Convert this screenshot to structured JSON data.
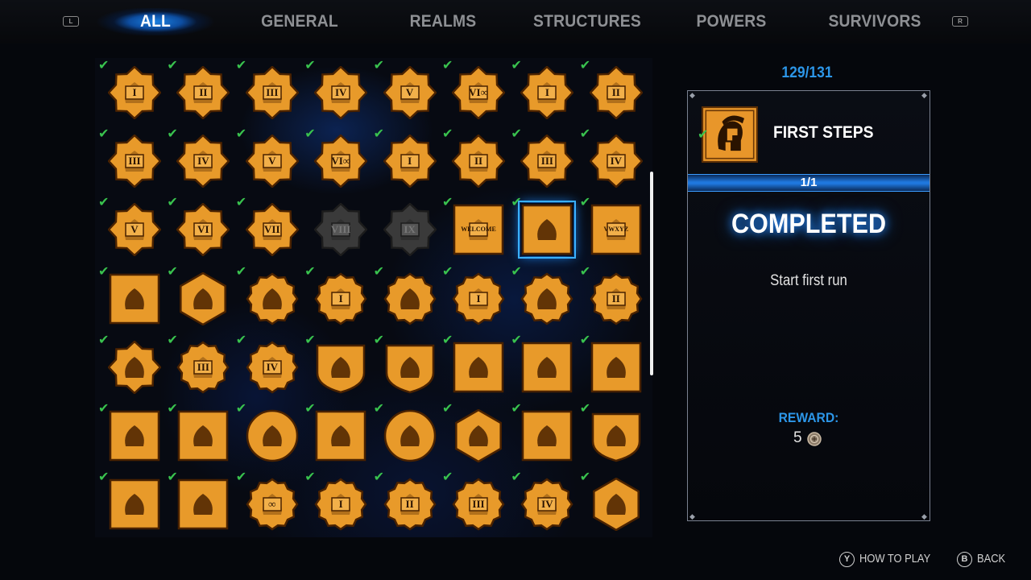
{
  "tabs": {
    "left_shoulder": "L",
    "right_shoulder": "R",
    "items": [
      {
        "label": "ALL",
        "active": true
      },
      {
        "label": "GENERAL",
        "active": false
      },
      {
        "label": "REALMS",
        "active": false
      },
      {
        "label": "STRUCTURES",
        "active": false
      },
      {
        "label": "POWERS",
        "active": false
      },
      {
        "label": "SURVIVORS",
        "active": false
      }
    ]
  },
  "grid": {
    "columns": 8,
    "achievements": [
      {
        "icon": "star-badge-flame-icon",
        "numeral": "I",
        "done": true
      },
      {
        "icon": "star-badge-flame-icon",
        "numeral": "II",
        "done": true
      },
      {
        "icon": "star-badge-flame-icon",
        "numeral": "III",
        "done": true
      },
      {
        "icon": "star-badge-flame-icon",
        "numeral": "IV",
        "done": true
      },
      {
        "icon": "star-badge-flame-icon",
        "numeral": "V",
        "done": true
      },
      {
        "icon": "star-badge-flame-icon",
        "numeral": "VI∞",
        "done": true
      },
      {
        "icon": "star-badge-cards-icon",
        "numeral": "I",
        "done": true
      },
      {
        "icon": "star-badge-cards-icon",
        "numeral": "II",
        "done": true
      },
      {
        "icon": "star-badge-cards-icon",
        "numeral": "III",
        "done": true
      },
      {
        "icon": "star-badge-cards-icon",
        "numeral": "IV",
        "done": true
      },
      {
        "icon": "star-badge-cards-icon",
        "numeral": "V",
        "done": true
      },
      {
        "icon": "star-badge-cards-icon",
        "numeral": "VI∞",
        "done": true
      },
      {
        "icon": "star-badge-skull-icon",
        "numeral": "I",
        "done": true
      },
      {
        "icon": "star-badge-skull-icon",
        "numeral": "II",
        "done": true
      },
      {
        "icon": "star-badge-skull-icon",
        "numeral": "III",
        "done": true
      },
      {
        "icon": "star-badge-skull-icon",
        "numeral": "IV",
        "done": true
      },
      {
        "icon": "star-badge-skull-icon",
        "numeral": "V",
        "done": true
      },
      {
        "icon": "star-badge-skull-icon",
        "numeral": "VI",
        "done": true
      },
      {
        "icon": "star-badge-skull-icon",
        "numeral": "VII",
        "done": true
      },
      {
        "icon": "star-badge-skull-icon",
        "numeral": "VIII",
        "done": false
      },
      {
        "icon": "star-badge-skull-icon",
        "numeral": "IX",
        "done": false
      },
      {
        "icon": "welcome-fire-icon",
        "numeral": "WELCOME",
        "done": true
      },
      {
        "icon": "spartan-helmet-icon",
        "numeral": "",
        "done": true,
        "selected": true
      },
      {
        "icon": "alphabet-tablet-icon",
        "numeral": "VWXYZ",
        "done": true
      },
      {
        "icon": "fruit-basket-icon",
        "numeral": "",
        "done": true
      },
      {
        "icon": "gold-bars-icon",
        "numeral": "",
        "done": true
      },
      {
        "icon": "laurel-face-icon",
        "numeral": "",
        "done": true
      },
      {
        "icon": "laurel-coin-icon",
        "numeral": "I",
        "done": true
      },
      {
        "icon": "temple-icon",
        "numeral": "",
        "done": true
      },
      {
        "icon": "laurel-sun-icon",
        "numeral": "I",
        "done": true
      },
      {
        "icon": "volcano-icon",
        "numeral": "",
        "done": true
      },
      {
        "icon": "laurel-sun-icon",
        "numeral": "II",
        "done": true
      },
      {
        "icon": "star-badge-cards-icon",
        "numeral": "",
        "done": true
      },
      {
        "icon": "laurel-sun-icon",
        "numeral": "III",
        "done": true
      },
      {
        "icon": "laurel-sun-icon",
        "numeral": "IV",
        "done": true
      },
      {
        "icon": "winged-sword-shield-icon",
        "numeral": "",
        "done": true
      },
      {
        "icon": "god-statue-shield-icon",
        "numeral": "",
        "done": true
      },
      {
        "icon": "treasure-chest-icon",
        "numeral": "",
        "done": true
      },
      {
        "icon": "spell-book-icon",
        "numeral": "",
        "done": true
      },
      {
        "icon": "ram-demon-icon",
        "numeral": "",
        "done": true
      },
      {
        "icon": "crowned-skull-icon",
        "numeral": "",
        "done": true
      },
      {
        "icon": "hooded-figure-icon",
        "numeral": "",
        "done": true
      },
      {
        "icon": "warrior-fist-icon",
        "numeral": "",
        "done": true
      },
      {
        "icon": "hammer-warrior-icon",
        "numeral": "",
        "done": true
      },
      {
        "icon": "flexing-arm-icon",
        "numeral": "",
        "done": true
      },
      {
        "icon": "miner-helmet-icon",
        "numeral": "",
        "done": true
      },
      {
        "icon": "duo-fighters-icon",
        "numeral": "",
        "done": true
      },
      {
        "icon": "shield-warrior-icon",
        "numeral": "",
        "done": true
      },
      {
        "icon": "castle-tower-icon",
        "numeral": "",
        "done": true
      },
      {
        "icon": "oracle-icon",
        "numeral": "",
        "done": true
      },
      {
        "icon": "laurel-infinity-icon",
        "numeral": "∞",
        "done": true
      },
      {
        "icon": "clover-numeral-icon",
        "numeral": "I",
        "done": true
      },
      {
        "icon": "clover-numeral-icon",
        "numeral": "II",
        "done": true
      },
      {
        "icon": "clover-numeral-icon",
        "numeral": "III",
        "done": true
      },
      {
        "icon": "clover-numeral-icon",
        "numeral": "IV",
        "done": true
      },
      {
        "icon": "hexagon-beast-icon",
        "numeral": "",
        "done": true
      }
    ]
  },
  "detail": {
    "count": "129/131",
    "icon": "spartan-helmet-icon",
    "title": "FIRST STEPS",
    "progress_text": "1/1",
    "progress_fraction": 1,
    "status": "COMPLETED",
    "description": "Start first run",
    "reward_label": "REWARD:",
    "reward_value": "5",
    "reward_icon": "coin-icon"
  },
  "prompts": {
    "how_to_play": {
      "button": "Y",
      "label": "HOW TO PLAY"
    },
    "back": {
      "button": "B",
      "label": "BACK"
    }
  },
  "colors": {
    "accent_blue": "#2c96e8",
    "gold": "#e89a2a",
    "check_green": "#39c24e"
  }
}
